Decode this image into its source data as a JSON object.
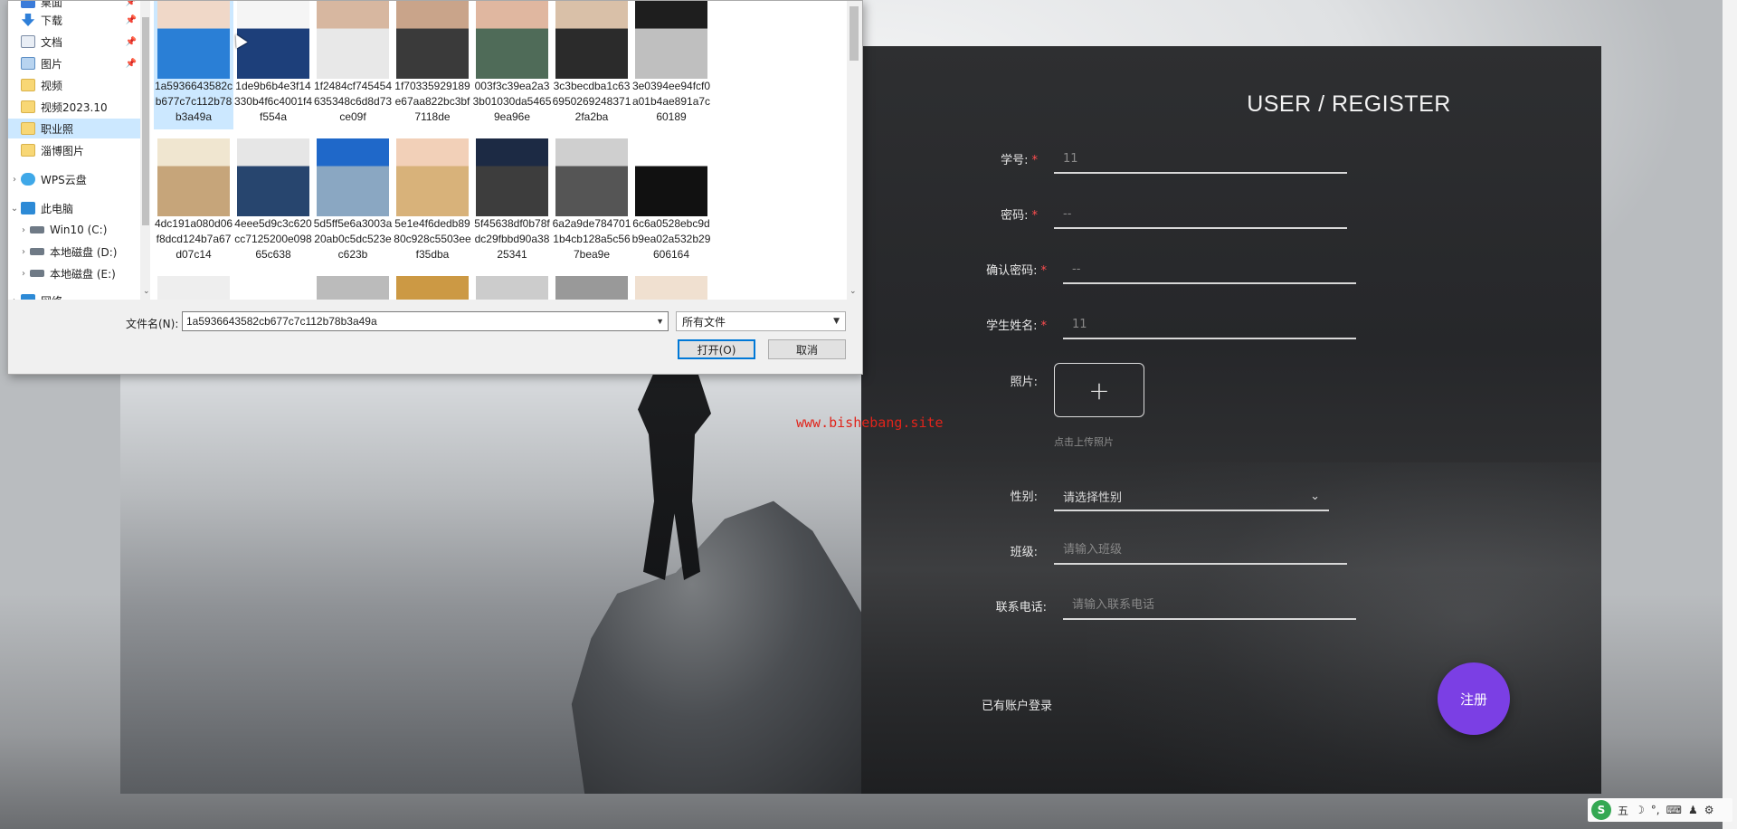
{
  "watermark": "www.bishebang.site",
  "register_form": {
    "title": "USER / REGISTER",
    "fields": [
      {
        "label": "学号:",
        "required": true,
        "placeholder": "11"
      },
      {
        "label": "密码:",
        "required": true,
        "placeholder": "--"
      },
      {
        "label": "确认密码:",
        "required": true,
        "placeholder": "--"
      },
      {
        "label": "学生姓名:",
        "required": true,
        "placeholder": "11"
      }
    ],
    "photo": {
      "label": "照片:",
      "plus": "+",
      "hint": "点击上传照片"
    },
    "gender": {
      "label": "性别:",
      "placeholder": "请选择性别",
      "chevron": "⌄"
    },
    "class": {
      "label": "班级:",
      "placeholder": "请输入班级"
    },
    "phone": {
      "label": "联系电话:",
      "placeholder": "请输入联系电话"
    },
    "login_link": "已有账户登录",
    "register_button": "注册",
    "accent_color": "#7b3fe4"
  },
  "file_dialog": {
    "nav_items": [
      {
        "label": "桌面",
        "icon": "folder-blue-icon",
        "pinned": true
      },
      {
        "label": "下载",
        "icon": "download-icon",
        "pinned": true
      },
      {
        "label": "文档",
        "icon": "document-icon",
        "pinned": true
      },
      {
        "label": "图片",
        "icon": "picture-icon",
        "pinned": true
      },
      {
        "label": "视频",
        "icon": "folder-icon",
        "pinned": false
      },
      {
        "label": "视频2023.10",
        "icon": "folder-icon",
        "pinned": false
      },
      {
        "label": "职业照",
        "icon": "folder-icon",
        "pinned": false,
        "selected": true
      },
      {
        "label": "淄博图片",
        "icon": "folder-icon",
        "pinned": false
      },
      {
        "label": "WPS云盘",
        "icon": "cloud-icon",
        "pinned": false,
        "expander": "›"
      },
      {
        "label": "此电脑",
        "icon": "computer-icon",
        "pinned": false,
        "expander": "⌄"
      },
      {
        "label": "Win10 (C:)",
        "icon": "drive-icon",
        "pinned": false,
        "expander": "›"
      },
      {
        "label": "本地磁盘 (D:)",
        "icon": "drive-icon",
        "pinned": false,
        "expander": "›"
      },
      {
        "label": "本地磁盘 (E:)",
        "icon": "drive-icon",
        "pinned": false,
        "expander": "›"
      },
      {
        "label": "网络",
        "icon": "network-icon",
        "pinned": false,
        "expander": "›"
      }
    ],
    "files": [
      {
        "name": "1a5936643582cb677c7c112b78b3a49a",
        "selected": true
      },
      {
        "name": "1de9b6b4e3f14330b4f6c4001f4f554a"
      },
      {
        "name": "1f2484cf745454635348c6d8d73ce09f"
      },
      {
        "name": "1f70335929189e67aa822bc3bf7118de"
      },
      {
        "name": "003f3c39ea2a33b01030da54659ea96e"
      },
      {
        "name": "3c3becdba1c636950269248371 2fa2ba"
      },
      {
        "name": "3e0394ee94fcf0a01b4ae891a7c60189"
      },
      {
        "name": "4dc191a080d06f8dcd124b7a67d07c14"
      },
      {
        "name": "4eee5d9c3c620cc7125200e09865c638"
      },
      {
        "name": "5d5ff5e6a3003a20ab0c5dc523ec623b"
      },
      {
        "name": "5e1e4f6dedb8980c928c5503eef35dba"
      },
      {
        "name": "5f45638df0b78fdc29fbbd90a3825341"
      },
      {
        "name": "6a2a9de7847011b4cb128a5c567bea9e"
      },
      {
        "name": "6c6a0528ebc9db9ea02a532b29606164"
      },
      {
        "name": ""
      },
      {
        "name": ""
      },
      {
        "name": ""
      },
      {
        "name": ""
      },
      {
        "name": ""
      },
      {
        "name": ""
      },
      {
        "name": ""
      }
    ],
    "filename_label": "文件名(N):",
    "filename_value": "1a5936643582cb677c7c112b78b3a49a",
    "filetype_value": "所有文件",
    "open_button": "打开(O)",
    "cancel_button": "取消"
  },
  "tray": {
    "ime": "五",
    "items": [
      "☽",
      "°,",
      "⌨",
      "♟",
      "⚙"
    ]
  }
}
